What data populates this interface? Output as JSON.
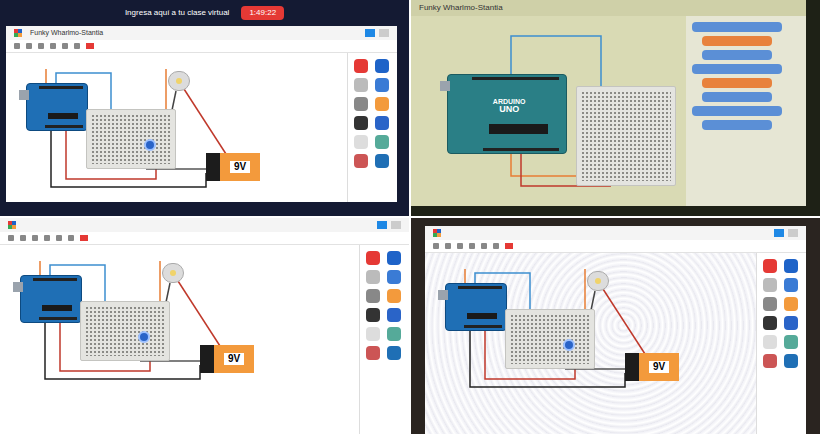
{
  "panels": [
    {
      "kind": "laptop",
      "meeting_bar": {
        "text": "Ingresa aquí a tu clase virtual",
        "button": "1:49:22"
      },
      "app_title": "Funky Wharlmo-Stantia",
      "battery": "9V"
    },
    {
      "kind": "blocks",
      "app_title": "Funky Wharlmo-Stantia",
      "arduino": {
        "brand": "ARDUINO",
        "model": "UNO"
      }
    },
    {
      "kind": "screen",
      "battery": "9V"
    },
    {
      "kind": "moire",
      "battery": "9V"
    }
  ]
}
